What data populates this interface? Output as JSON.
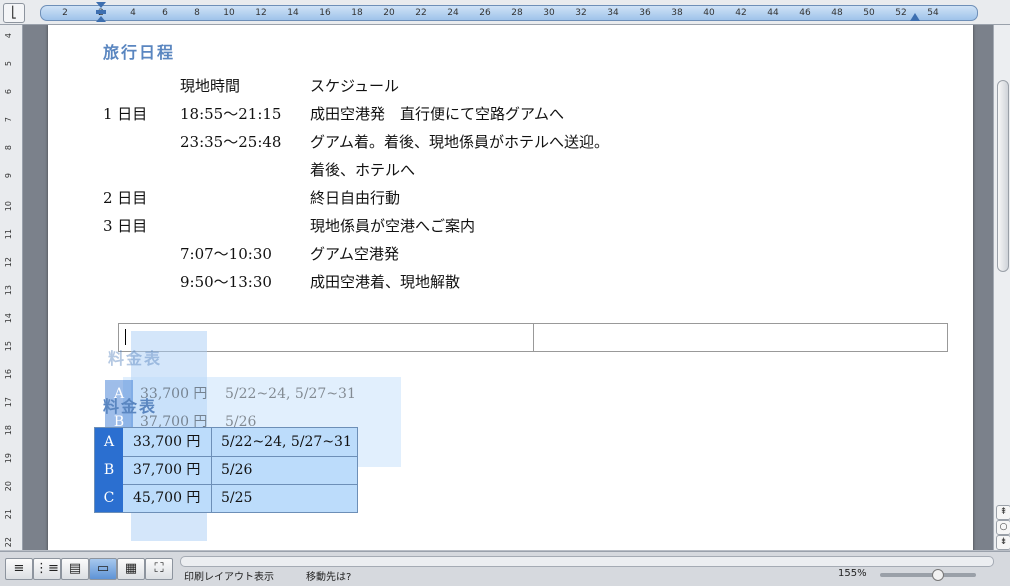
{
  "ruler": {
    "corner_glyph": "⎣",
    "ticks": [
      "2",
      "2",
      "4",
      "6",
      "8",
      "10",
      "12",
      "14",
      "16",
      "18",
      "20",
      "22",
      "24",
      "26",
      "28",
      "30",
      "32",
      "34",
      "36",
      "38",
      "40",
      "42",
      "44",
      "46",
      "48",
      "50",
      "52",
      "54"
    ],
    "vertical_ticks": [
      "4",
      "5",
      "6",
      "7",
      "8",
      "9",
      "10",
      "11",
      "12",
      "13",
      "14",
      "15",
      "16",
      "17",
      "18",
      "19",
      "20",
      "21",
      "22"
    ]
  },
  "document": {
    "itinerary_heading": "旅行日程",
    "col_time_header": "現地時間",
    "col_schedule_header": "スケジュール",
    "rows": [
      {
        "day": "1 日目",
        "time": "18:55～21:15",
        "text": "成田空港発　直行便にて空路グアムへ"
      },
      {
        "day": "",
        "time": "23:35～25:48",
        "text": "グアム着。着後、現地係員がホテルへ送迎。"
      },
      {
        "day": "",
        "time": "",
        "text": "着後、ホテルへ"
      },
      {
        "day": "2 日目",
        "time": "",
        "text": "終日自由行動"
      },
      {
        "day": "3 日目",
        "time": "",
        "text": "現地係員が空港へご案内"
      },
      {
        "day": "",
        "time": "7:07～10:30",
        "text": "グアム空港発"
      },
      {
        "day": "",
        "time": "9:50～13:30",
        "text": "成田空港着、現地解散"
      }
    ],
    "price_heading": "料金表",
    "price_table": [
      {
        "code": "A",
        "price": "33,700 円",
        "dates": "5/22~24, 5/27~31"
      },
      {
        "code": "B",
        "price": "37,700 円",
        "dates": "5/26"
      },
      {
        "code": "C",
        "price": "45,700 円",
        "dates": "5/25"
      }
    ]
  },
  "status": {
    "view_mode": "印刷レイアウト表示",
    "goto_label": "移動先は?",
    "zoom": "155%"
  },
  "scroll_buttons": [
    "⇞",
    "○",
    "⇟"
  ],
  "view_buttons": [
    "≡",
    "⋮≡",
    "▤",
    "▭",
    "▦",
    "⛶"
  ],
  "colors": {
    "accent": "#5a86c0",
    "selection": "#bcdcfb",
    "letter_bg": "#2b6fd0"
  }
}
